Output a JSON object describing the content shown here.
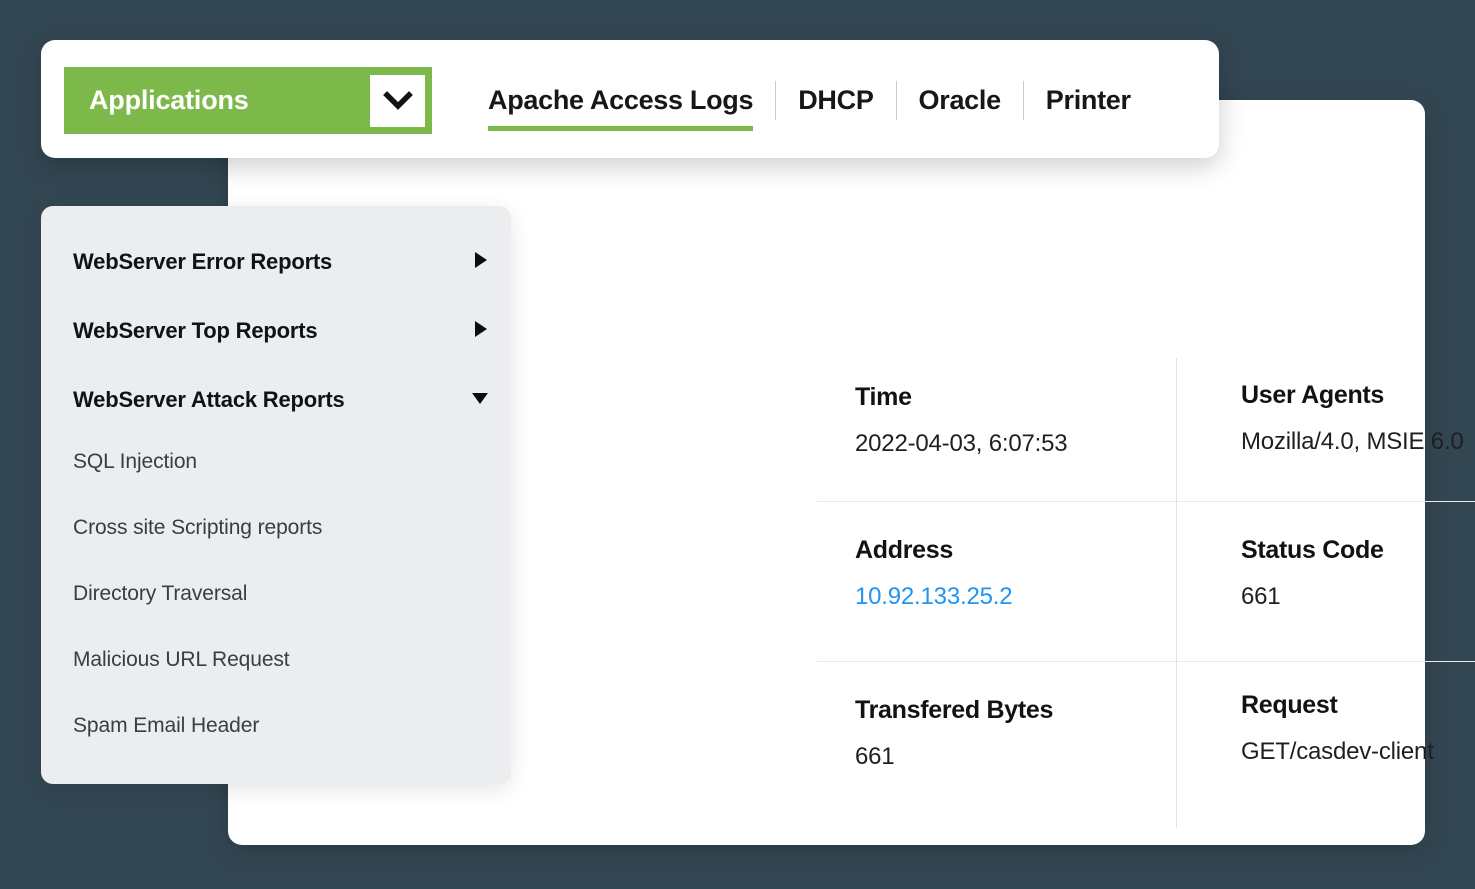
{
  "theme": {
    "page_background": "#334753",
    "accent_green": "#7DB84A",
    "panel_white": "#ffffff",
    "sidebar_gray": "#ebedee",
    "link_blue": "#2094f3",
    "heading_black": "#101214",
    "divider_gray": "#dfe1e3"
  },
  "header": {
    "dropdown": {
      "label": "Applications",
      "caret_icon": "chevron-down-icon"
    },
    "tabs": [
      {
        "label": "Apache Access Logs",
        "active": true
      },
      {
        "label": "DHCP",
        "active": false
      },
      {
        "label": "Oracle",
        "active": false
      },
      {
        "label": "Printer",
        "active": false
      }
    ]
  },
  "sidebar": {
    "groups": [
      {
        "label": "WebServer Error Reports",
        "expanded": false,
        "arrow_icon": "triangle-right-icon"
      },
      {
        "label": "WebServer Top Reports",
        "expanded": false,
        "arrow_icon": "triangle-right-icon"
      },
      {
        "label": "WebServer Attack Reports",
        "expanded": true,
        "arrow_icon": "triangle-down-icon"
      }
    ],
    "items": [
      {
        "label": "SQL Injection"
      },
      {
        "label": "Cross site Scripting reports"
      },
      {
        "label": "Directory Traversal"
      },
      {
        "label": "Malicious URL Request"
      },
      {
        "label": "Spam Email Header"
      }
    ]
  },
  "detail": {
    "fields": [
      {
        "label": "Time",
        "value": "2022-04-03, 6:07:53",
        "is_link": false
      },
      {
        "label": "User Agents",
        "value": "Mozilla/4.0, MSIE 6.0",
        "is_link": false
      },
      {
        "label": "Address",
        "value": "10.92.133.25.2",
        "is_link": true
      },
      {
        "label": "Status Code",
        "value": "661",
        "is_link": false
      },
      {
        "label": "Transfered Bytes",
        "value": "661",
        "is_link": false
      },
      {
        "label": "Request",
        "value": "GET/casdev-client",
        "is_link": false
      }
    ]
  }
}
